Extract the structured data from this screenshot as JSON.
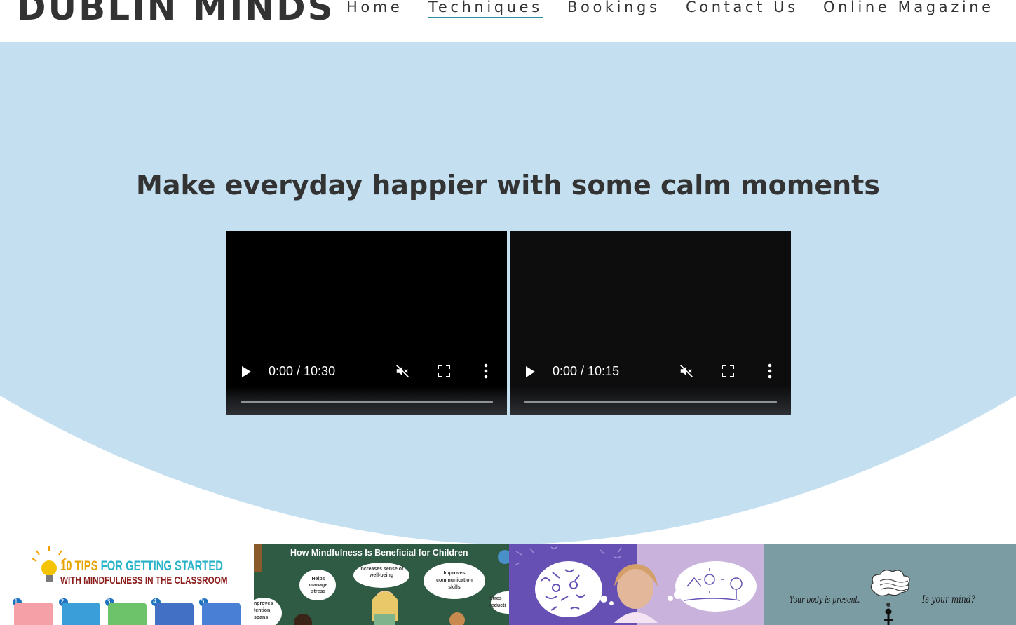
{
  "site": {
    "logo": "DUBLIN MINDS"
  },
  "nav": {
    "items": [
      {
        "label": "Home",
        "active": false
      },
      {
        "label": "Techniques",
        "active": true
      },
      {
        "label": "Bookings",
        "active": false
      },
      {
        "label": "Contact Us",
        "active": false
      },
      {
        "label": "Online Magazine",
        "active": false
      }
    ]
  },
  "hero": {
    "title": "Make everyday happier with some calm moments",
    "background_color": "#c3dff0"
  },
  "videos": [
    {
      "time": "0:00 / 10:30",
      "muted": true
    },
    {
      "time": "0:00 / 10:15",
      "muted": true
    }
  ],
  "gallery": [
    {
      "line1_a": "10 TIPS",
      "line1_b": "FOR GETTING STARTED",
      "line2": "WITH MINDFULNESS IN THE CLASSROOM",
      "steps": [
        "1.",
        "2.",
        "3.",
        "4.",
        "5."
      ]
    },
    {
      "title": "How Mindfulness Is Beneficial for Children",
      "bubbles": [
        "Helps manage stress",
        "Increases sense of well-being",
        "Improves communication skills"
      ],
      "left_text": "nproves tention spans",
      "right_text": "Stres reducti"
    },
    {},
    {
      "left_caption": "Your body is present.",
      "right_caption": "Is your mind?"
    }
  ],
  "colors": {
    "nav_active_underline": "#2a8fa3",
    "text": "#333333",
    "tile1_title": "#e6a400",
    "tile1_accent": "#26b3c8",
    "tile1_subtitle": "#8a1c1c",
    "tile3_bg": "#6650b4",
    "tile4_bg": "#7c9ca3"
  }
}
